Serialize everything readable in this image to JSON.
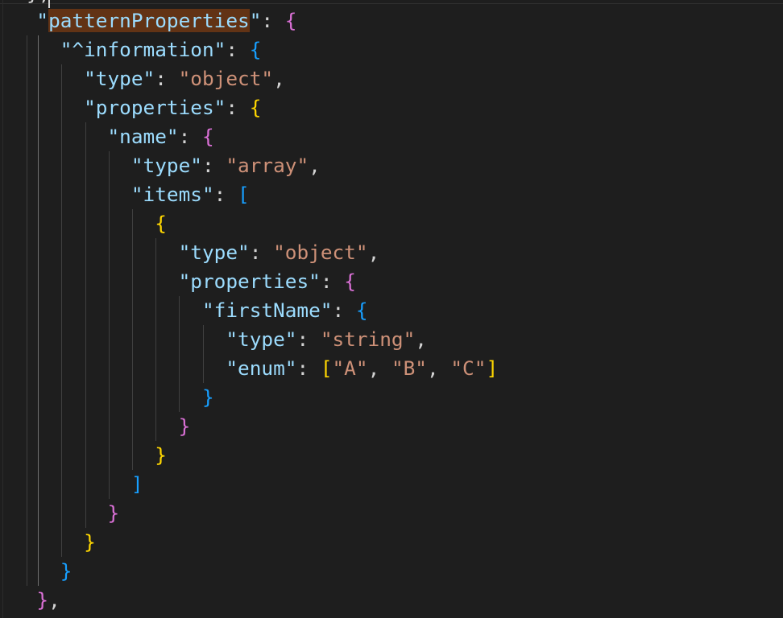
{
  "code": {
    "prev_line_fragment": "},",
    "lines": [
      {
        "indent": "  ",
        "tokens": [
          {
            "t": "\"",
            "c": "key"
          },
          {
            "t": "patternProperties",
            "c": "key hl"
          },
          {
            "t": "\"",
            "c": "key"
          },
          {
            "t": ": ",
            "c": "punc"
          },
          {
            "t": "{",
            "c": "b2"
          }
        ]
      },
      {
        "indent": "    ",
        "tokens": [
          {
            "t": "\"^information\"",
            "c": "key"
          },
          {
            "t": ": ",
            "c": "punc"
          },
          {
            "t": "{",
            "c": "b3"
          }
        ]
      },
      {
        "indent": "      ",
        "tokens": [
          {
            "t": "\"type\"",
            "c": "key"
          },
          {
            "t": ": ",
            "c": "punc"
          },
          {
            "t": "\"object\"",
            "c": "str"
          },
          {
            "t": ",",
            "c": "punc"
          }
        ]
      },
      {
        "indent": "      ",
        "tokens": [
          {
            "t": "\"properties\"",
            "c": "key"
          },
          {
            "t": ": ",
            "c": "punc"
          },
          {
            "t": "{",
            "c": "b1"
          }
        ]
      },
      {
        "indent": "        ",
        "tokens": [
          {
            "t": "\"name\"",
            "c": "key"
          },
          {
            "t": ": ",
            "c": "punc"
          },
          {
            "t": "{",
            "c": "b2"
          }
        ]
      },
      {
        "indent": "          ",
        "tokens": [
          {
            "t": "\"type\"",
            "c": "key"
          },
          {
            "t": ": ",
            "c": "punc"
          },
          {
            "t": "\"array\"",
            "c": "str"
          },
          {
            "t": ",",
            "c": "punc"
          }
        ]
      },
      {
        "indent": "          ",
        "tokens": [
          {
            "t": "\"items\"",
            "c": "key"
          },
          {
            "t": ": ",
            "c": "punc"
          },
          {
            "t": "[",
            "c": "b3"
          }
        ]
      },
      {
        "indent": "            ",
        "tokens": [
          {
            "t": "{",
            "c": "b1"
          }
        ]
      },
      {
        "indent": "              ",
        "tokens": [
          {
            "t": "\"type\"",
            "c": "key"
          },
          {
            "t": ": ",
            "c": "punc"
          },
          {
            "t": "\"object\"",
            "c": "str"
          },
          {
            "t": ",",
            "c": "punc"
          }
        ]
      },
      {
        "indent": "              ",
        "tokens": [
          {
            "t": "\"properties\"",
            "c": "key"
          },
          {
            "t": ": ",
            "c": "punc"
          },
          {
            "t": "{",
            "c": "b2"
          }
        ]
      },
      {
        "indent": "                ",
        "tokens": [
          {
            "t": "\"firstName\"",
            "c": "key"
          },
          {
            "t": ": ",
            "c": "punc"
          },
          {
            "t": "{",
            "c": "b3"
          }
        ]
      },
      {
        "indent": "                  ",
        "tokens": [
          {
            "t": "\"type\"",
            "c": "key"
          },
          {
            "t": ": ",
            "c": "punc"
          },
          {
            "t": "\"string\"",
            "c": "str"
          },
          {
            "t": ",",
            "c": "punc"
          }
        ]
      },
      {
        "indent": "                  ",
        "tokens": [
          {
            "t": "\"enum\"",
            "c": "key"
          },
          {
            "t": ": ",
            "c": "punc"
          },
          {
            "t": "[",
            "c": "b1"
          },
          {
            "t": "\"A\"",
            "c": "str"
          },
          {
            "t": ", ",
            "c": "punc"
          },
          {
            "t": "\"B\"",
            "c": "str"
          },
          {
            "t": ", ",
            "c": "punc"
          },
          {
            "t": "\"C\"",
            "c": "str"
          },
          {
            "t": "]",
            "c": "b1"
          }
        ]
      },
      {
        "indent": "                ",
        "tokens": [
          {
            "t": "}",
            "c": "b3"
          }
        ]
      },
      {
        "indent": "              ",
        "tokens": [
          {
            "t": "}",
            "c": "b2"
          }
        ]
      },
      {
        "indent": "            ",
        "tokens": [
          {
            "t": "}",
            "c": "b1"
          }
        ]
      },
      {
        "indent": "          ",
        "tokens": [
          {
            "t": "]",
            "c": "b3"
          }
        ]
      },
      {
        "indent": "        ",
        "tokens": [
          {
            "t": "}",
            "c": "b2"
          }
        ]
      },
      {
        "indent": "      ",
        "tokens": [
          {
            "t": "}",
            "c": "b1"
          }
        ]
      },
      {
        "indent": "    ",
        "tokens": [
          {
            "t": "}",
            "c": "b3"
          }
        ]
      },
      {
        "indent": "  ",
        "tokens": [
          {
            "t": "}",
            "c": "b2"
          },
          {
            "t": ",",
            "c": "punc"
          }
        ]
      }
    ]
  },
  "colors": {
    "background": "#1e1e1e",
    "key": "#9cdcfe",
    "string": "#ce9178",
    "bracket_gold": "#ffd700",
    "bracket_orchid": "#da70d6",
    "bracket_blue": "#179fff",
    "search_highlight": "#623315"
  }
}
